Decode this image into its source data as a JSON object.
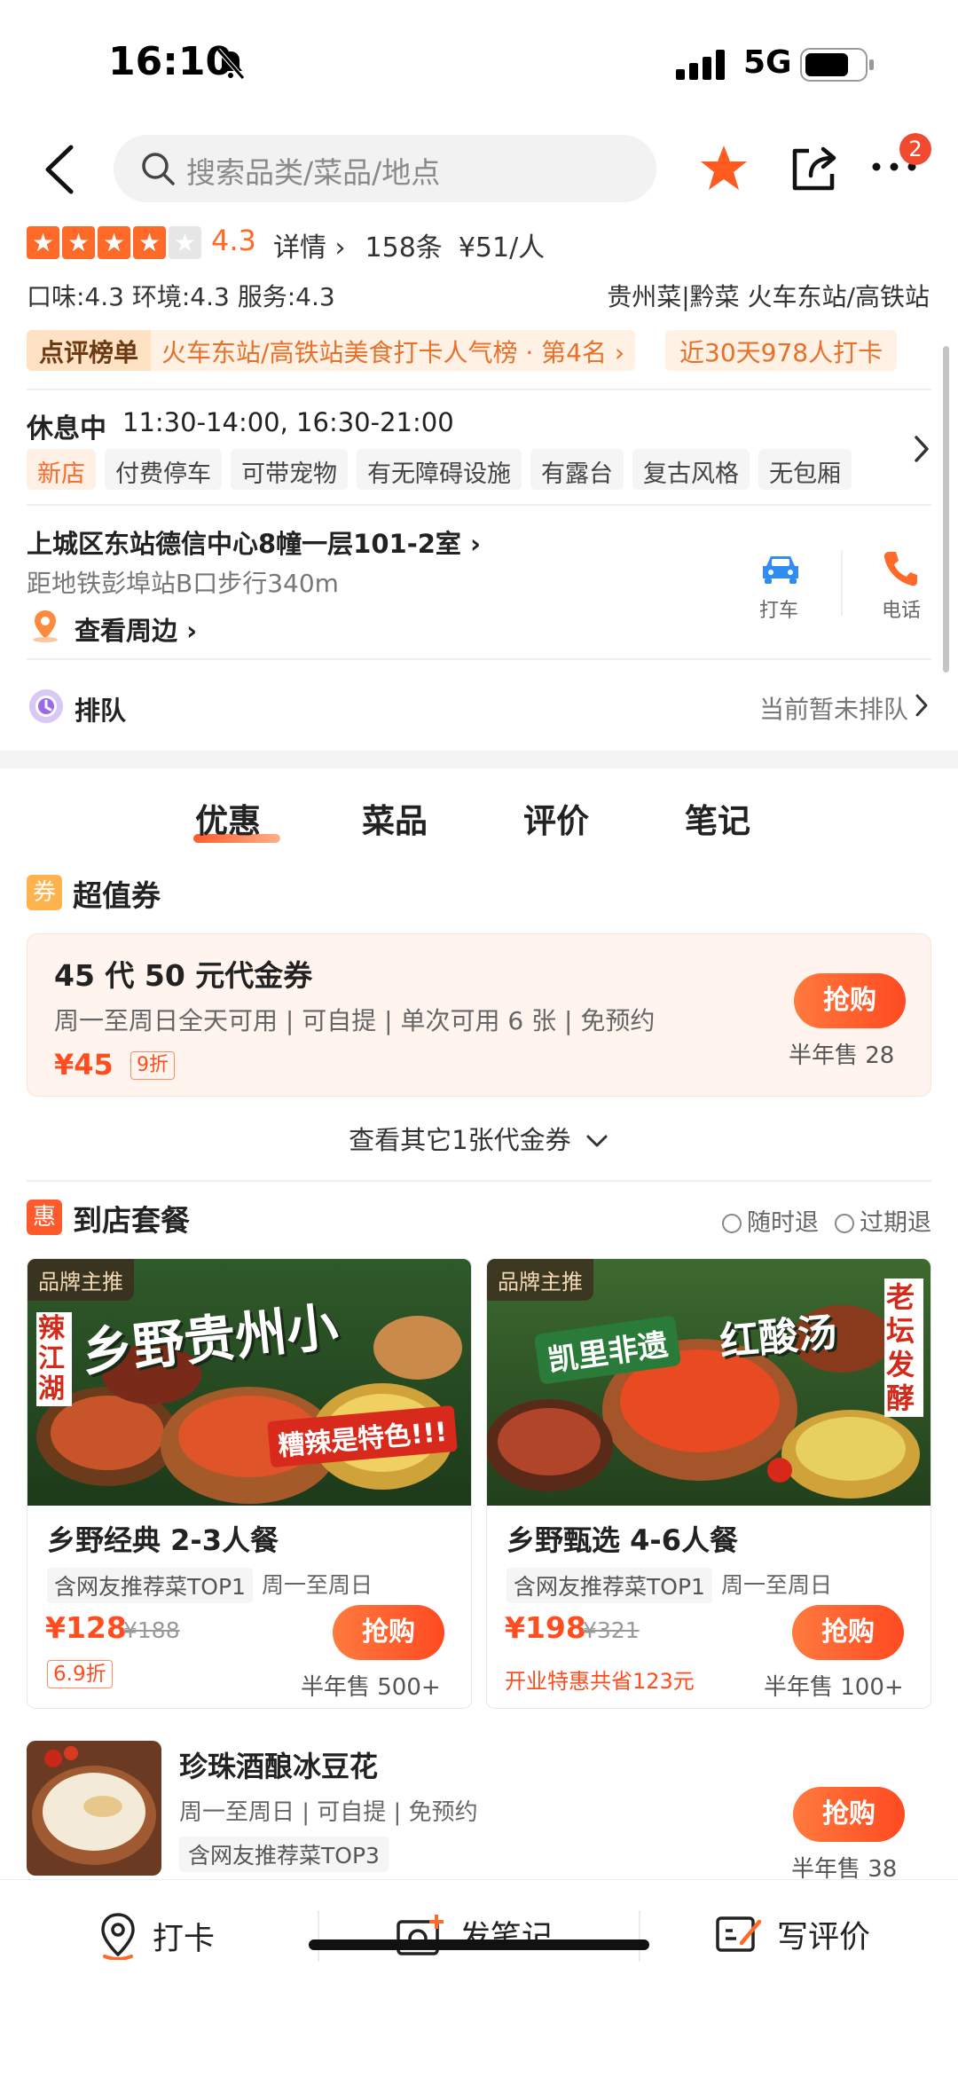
{
  "status": {
    "time": "16:10",
    "network": "5G"
  },
  "header": {
    "search_placeholder": "搜索品类/菜品/地点",
    "notification_count": "2"
  },
  "shop": {
    "stars": [
      1,
      1,
      1,
      1,
      0
    ],
    "rating": "4.3",
    "details": "详情",
    "review_count": "158条",
    "avg_price": "¥51/人",
    "scores": "口味:4.3  环境:4.3  服务:4.3",
    "cuisine": "贵州菜|黔菜   火车东站/高铁站",
    "rank_label": "点评榜单",
    "rank_text": "火车东站/高铁站美食打卡人气榜 · 第4名",
    "checkin": "近30天978人打卡"
  },
  "hours": {
    "label": "休息中",
    "time": "11:30-14:00, 16:30-21:00",
    "facilities": [
      "新店",
      "付费停车",
      "可带宠物",
      "有无障碍设施",
      "有露台",
      "复古风格",
      "无包厢"
    ]
  },
  "location": {
    "address": "上城区东站德信中心8幢一层101-2室",
    "distance": "距地铁彭埠站B口步行340m",
    "nearby": "查看周边",
    "taxi_label": "打车",
    "phone_label": "电话"
  },
  "queue": {
    "label": "排队",
    "status": "当前暂未排队"
  },
  "tabs": [
    "优惠",
    "菜品",
    "评价",
    "笔记"
  ],
  "vouchers": {
    "icon": "券",
    "title": "超值券",
    "item": {
      "name": "45 代 50 元代金券",
      "desc": "周一至周日全天可用 | 可自提 | 单次可用 6 张 | 免预约",
      "price": "¥45",
      "discount": "9折",
      "button": "抢购",
      "sold": "半年售 28"
    },
    "more": "查看其它1张代金券"
  },
  "combos": {
    "icon": "惠",
    "title": "到店套餐",
    "filters": [
      "随时退",
      "过期退"
    ],
    "items": [
      {
        "brand": "品牌主推",
        "banner_main": "乡野贵州小",
        "banner_side": "辣江湖",
        "banner_sub": "糟辣是特色!!!",
        "name": "乡野经典 2-3人餐",
        "tag": "含网友推荐菜TOP1",
        "days": "周一至周日",
        "price": "¥128",
        "orig": "¥188",
        "discount": "6.9折",
        "button": "抢购",
        "sold": "半年售 500+"
      },
      {
        "brand": "品牌主推",
        "banner_main": "凯里非遗",
        "banner_main2": "红酸汤",
        "banner_side": "老坛发酵",
        "name": "乡野甄选 4-6人餐",
        "tag": "含网友推荐菜TOP1",
        "days": "周一至周日",
        "price": "¥198",
        "orig": "¥321",
        "saving": "开业特惠共省123元",
        "button": "抢购",
        "sold": "半年售 100+"
      }
    ]
  },
  "dessert": {
    "name": "珍珠酒酿冰豆花",
    "desc": "周一至周日 | 可自提 | 免预约",
    "tag": "含网友推荐菜TOP3",
    "button": "抢购",
    "sold": "半年售 38"
  },
  "bottom_bar": [
    "打卡",
    "发笔记",
    "写评价"
  ],
  "colors": {
    "accent": "#ff6a28",
    "price": "#ff4d1f"
  }
}
